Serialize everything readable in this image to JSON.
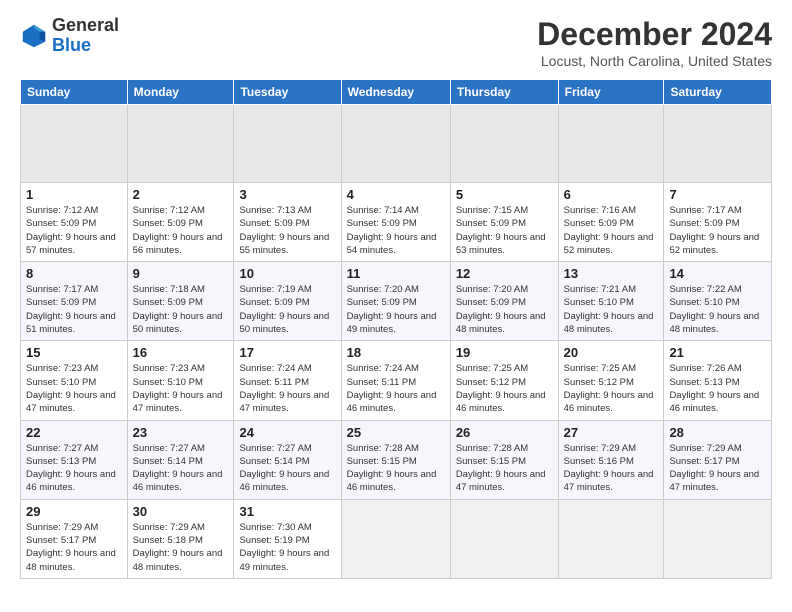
{
  "header": {
    "logo_general": "General",
    "logo_blue": "Blue",
    "title": "December 2024",
    "location": "Locust, North Carolina, United States"
  },
  "calendar": {
    "days_of_week": [
      "Sunday",
      "Monday",
      "Tuesday",
      "Wednesday",
      "Thursday",
      "Friday",
      "Saturday"
    ],
    "weeks": [
      [
        {
          "day": "",
          "empty": true
        },
        {
          "day": "",
          "empty": true
        },
        {
          "day": "",
          "empty": true
        },
        {
          "day": "",
          "empty": true
        },
        {
          "day": "",
          "empty": true
        },
        {
          "day": "",
          "empty": true
        },
        {
          "day": "",
          "empty": true
        }
      ],
      [
        {
          "day": "1",
          "sunrise": "7:12 AM",
          "sunset": "5:09 PM",
          "daylight": "9 hours and 57 minutes."
        },
        {
          "day": "2",
          "sunrise": "7:12 AM",
          "sunset": "5:09 PM",
          "daylight": "9 hours and 56 minutes."
        },
        {
          "day": "3",
          "sunrise": "7:13 AM",
          "sunset": "5:09 PM",
          "daylight": "9 hours and 55 minutes."
        },
        {
          "day": "4",
          "sunrise": "7:14 AM",
          "sunset": "5:09 PM",
          "daylight": "9 hours and 54 minutes."
        },
        {
          "day": "5",
          "sunrise": "7:15 AM",
          "sunset": "5:09 PM",
          "daylight": "9 hours and 53 minutes."
        },
        {
          "day": "6",
          "sunrise": "7:16 AM",
          "sunset": "5:09 PM",
          "daylight": "9 hours and 52 minutes."
        },
        {
          "day": "7",
          "sunrise": "7:17 AM",
          "sunset": "5:09 PM",
          "daylight": "9 hours and 52 minutes."
        }
      ],
      [
        {
          "day": "8",
          "sunrise": "7:17 AM",
          "sunset": "5:09 PM",
          "daylight": "9 hours and 51 minutes."
        },
        {
          "day": "9",
          "sunrise": "7:18 AM",
          "sunset": "5:09 PM",
          "daylight": "9 hours and 50 minutes."
        },
        {
          "day": "10",
          "sunrise": "7:19 AM",
          "sunset": "5:09 PM",
          "daylight": "9 hours and 50 minutes."
        },
        {
          "day": "11",
          "sunrise": "7:20 AM",
          "sunset": "5:09 PM",
          "daylight": "9 hours and 49 minutes."
        },
        {
          "day": "12",
          "sunrise": "7:20 AM",
          "sunset": "5:09 PM",
          "daylight": "9 hours and 48 minutes."
        },
        {
          "day": "13",
          "sunrise": "7:21 AM",
          "sunset": "5:10 PM",
          "daylight": "9 hours and 48 minutes."
        },
        {
          "day": "14",
          "sunrise": "7:22 AM",
          "sunset": "5:10 PM",
          "daylight": "9 hours and 48 minutes."
        }
      ],
      [
        {
          "day": "15",
          "sunrise": "7:23 AM",
          "sunset": "5:10 PM",
          "daylight": "9 hours and 47 minutes."
        },
        {
          "day": "16",
          "sunrise": "7:23 AM",
          "sunset": "5:10 PM",
          "daylight": "9 hours and 47 minutes."
        },
        {
          "day": "17",
          "sunrise": "7:24 AM",
          "sunset": "5:11 PM",
          "daylight": "9 hours and 47 minutes."
        },
        {
          "day": "18",
          "sunrise": "7:24 AM",
          "sunset": "5:11 PM",
          "daylight": "9 hours and 46 minutes."
        },
        {
          "day": "19",
          "sunrise": "7:25 AM",
          "sunset": "5:12 PM",
          "daylight": "9 hours and 46 minutes."
        },
        {
          "day": "20",
          "sunrise": "7:25 AM",
          "sunset": "5:12 PM",
          "daylight": "9 hours and 46 minutes."
        },
        {
          "day": "21",
          "sunrise": "7:26 AM",
          "sunset": "5:13 PM",
          "daylight": "9 hours and 46 minutes."
        }
      ],
      [
        {
          "day": "22",
          "sunrise": "7:27 AM",
          "sunset": "5:13 PM",
          "daylight": "9 hours and 46 minutes."
        },
        {
          "day": "23",
          "sunrise": "7:27 AM",
          "sunset": "5:14 PM",
          "daylight": "9 hours and 46 minutes."
        },
        {
          "day": "24",
          "sunrise": "7:27 AM",
          "sunset": "5:14 PM",
          "daylight": "9 hours and 46 minutes."
        },
        {
          "day": "25",
          "sunrise": "7:28 AM",
          "sunset": "5:15 PM",
          "daylight": "9 hours and 46 minutes."
        },
        {
          "day": "26",
          "sunrise": "7:28 AM",
          "sunset": "5:15 PM",
          "daylight": "9 hours and 47 minutes."
        },
        {
          "day": "27",
          "sunrise": "7:29 AM",
          "sunset": "5:16 PM",
          "daylight": "9 hours and 47 minutes."
        },
        {
          "day": "28",
          "sunrise": "7:29 AM",
          "sunset": "5:17 PM",
          "daylight": "9 hours and 47 minutes."
        }
      ],
      [
        {
          "day": "29",
          "sunrise": "7:29 AM",
          "sunset": "5:17 PM",
          "daylight": "9 hours and 48 minutes."
        },
        {
          "day": "30",
          "sunrise": "7:29 AM",
          "sunset": "5:18 PM",
          "daylight": "9 hours and 48 minutes."
        },
        {
          "day": "31",
          "sunrise": "7:30 AM",
          "sunset": "5:19 PM",
          "daylight": "9 hours and 49 minutes."
        },
        {
          "day": "",
          "empty": true
        },
        {
          "day": "",
          "empty": true
        },
        {
          "day": "",
          "empty": true
        },
        {
          "day": "",
          "empty": true
        }
      ]
    ]
  }
}
